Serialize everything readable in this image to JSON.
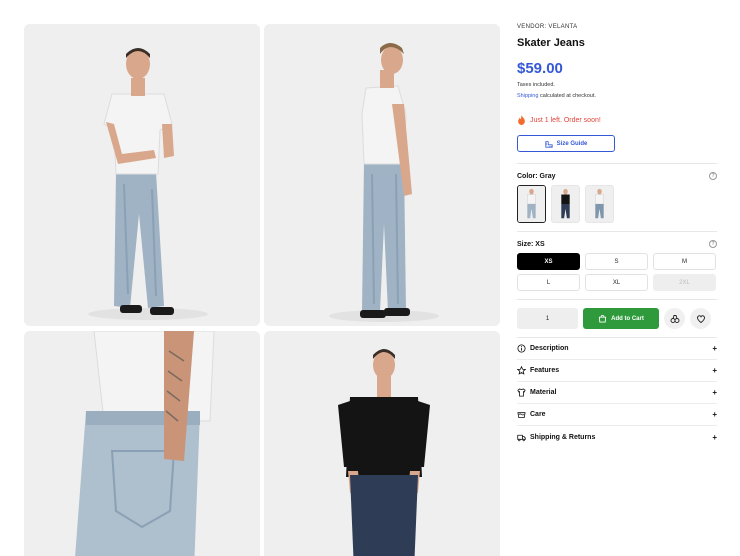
{
  "gallery": {
    "images": [
      {
        "name": "front-view-photo",
        "shirt": "#f2f2f2",
        "jeans": "#9fb3c4"
      },
      {
        "name": "side-view-photo",
        "shirt": "#f2f2f2",
        "jeans": "#9fb3c4"
      },
      {
        "name": "back-pocket-closeup-photo",
        "shirt": "#f2f2f2",
        "jeans": "#aebfcd"
      },
      {
        "name": "dark-wash-front-photo",
        "shirt": "#141414",
        "jeans": "#2e3c55"
      }
    ]
  },
  "product": {
    "vendor": "VENDOR: VELANTA",
    "title": "Skater Jeans",
    "price": "$59.00",
    "tax_note": "Taxes included.",
    "shipping_link": "Shipping",
    "shipping_note": " calculated at checkout.",
    "stock_message": "Just 1 left. Order soon!",
    "size_guide_label": "Size Guide",
    "color_label": "Color: Gray",
    "size_label": "Size: XS",
    "sizes": [
      {
        "label": "XS",
        "state": "active"
      },
      {
        "label": "S",
        "state": "normal"
      },
      {
        "label": "M",
        "state": "normal"
      },
      {
        "label": "L",
        "state": "normal"
      },
      {
        "label": "XL",
        "state": "normal"
      },
      {
        "label": "2XL",
        "state": "disabled"
      }
    ],
    "quantity": "1",
    "add_to_cart_label": "Add to Cart",
    "accordions": [
      {
        "label": "Description",
        "icon": "info-icon"
      },
      {
        "label": "Features",
        "icon": "star-icon"
      },
      {
        "label": "Material",
        "icon": "shirt-icon"
      },
      {
        "label": "Care",
        "icon": "care-icon"
      },
      {
        "label": "Shipping & Returns",
        "icon": "truck-icon"
      }
    ]
  },
  "colors": {
    "accent": "#3559d6",
    "cta": "#2f9a3c",
    "alert": "#e0453a"
  }
}
